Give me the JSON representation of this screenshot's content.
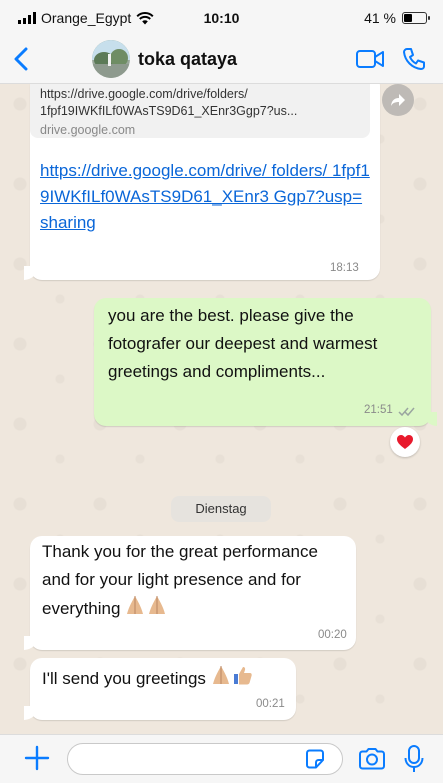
{
  "status_bar": {
    "carrier": "Orange_Egypt",
    "time": "10:10",
    "battery": "41 %",
    "battery_level": 0.41
  },
  "header": {
    "contact_name": "toka qataya",
    "back_icon": "chevron-left-icon",
    "video_icon": "video-camera-icon",
    "call_icon": "phone-icon"
  },
  "messages": {
    "link": {
      "preview_url": "https://drive.google.com/drive/folders/ 1fpf19IWKfILf0WAsTS9D61_XEnr3Ggp7?us...",
      "preview_domain": "drive.google.com",
      "url": "https://drive.google.com/drive/ folders/ 1fpf19IWKfILf0WAsTS9D61_XEnr3 Ggp7?usp=sharing",
      "time": "18:13"
    },
    "outgoing": {
      "text": "you are the best. please give the fotografer our deepest and warmest greetings and compliments...",
      "time": "21:51",
      "reaction": "heart"
    },
    "day_label": "Dienstag",
    "incoming_1": {
      "text": "Thank you for the great performance and for your light presence and for everything",
      "emojis": "praying-hands",
      "time": "00:20"
    },
    "incoming_2": {
      "text": "I'll send you greetings",
      "emojis": "praying-hands thumbs-up",
      "time": "00:21"
    }
  },
  "input_bar": {
    "placeholder": ""
  },
  "colors": {
    "accent": "#0a7cff",
    "link": "#0a66d8",
    "outgoing_bubble": "#dcf8c6",
    "chat_background": "#efe7dd",
    "heart": "#e8192c"
  }
}
